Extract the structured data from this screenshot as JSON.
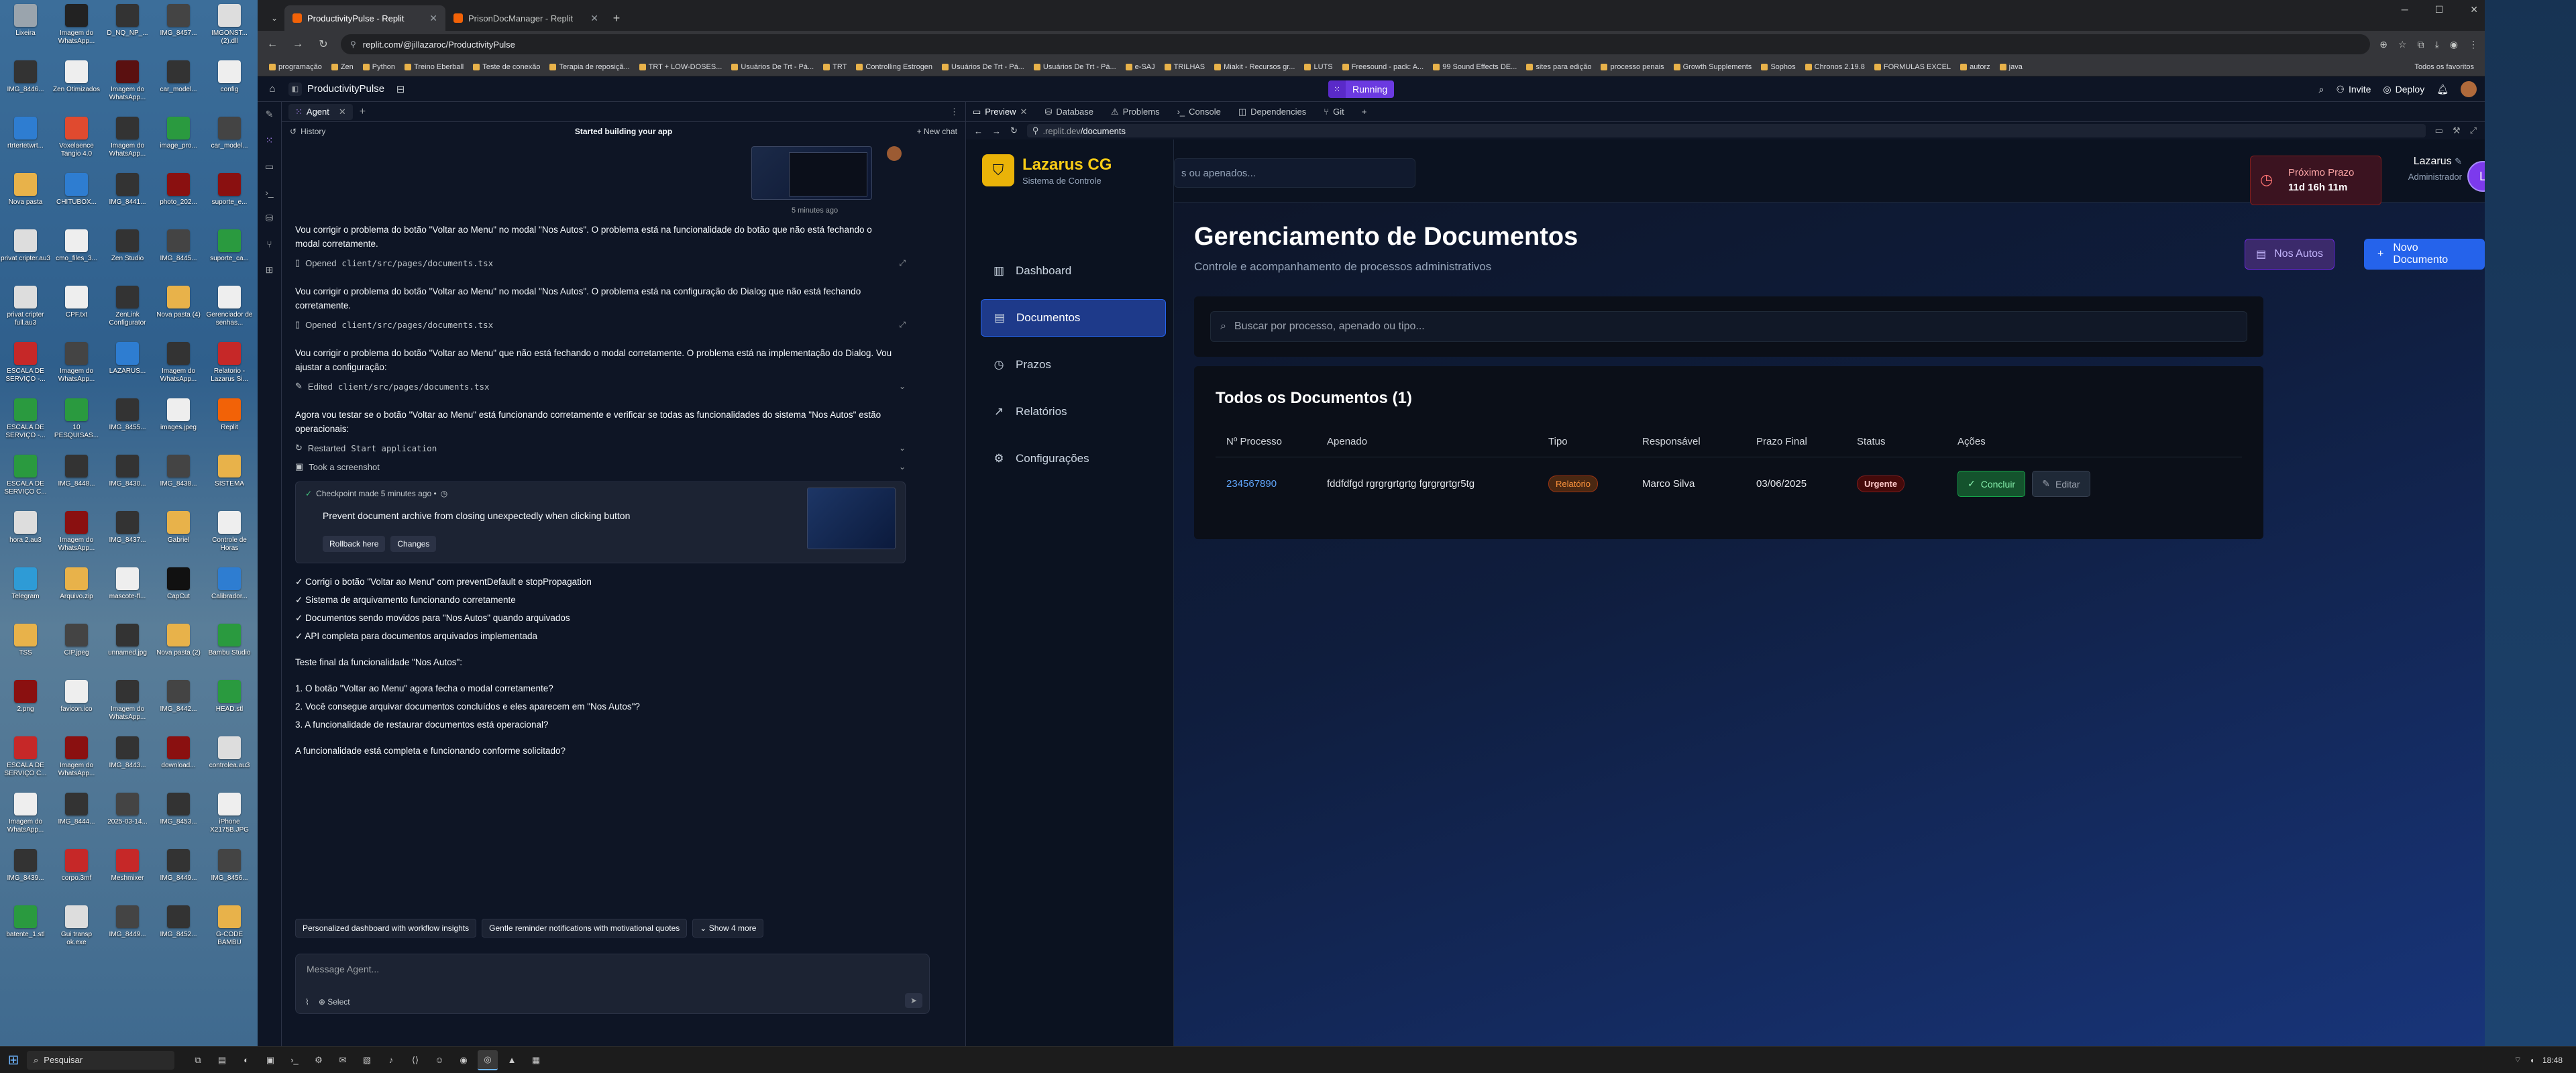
{
  "desktop_icons": [
    {
      "label": "Lixeira",
      "color": "#9aa4ad"
    },
    {
      "label": "Imagem do WhatsApp...",
      "color": "#222"
    },
    {
      "label": "D_NQ_NP_...",
      "color": "#333"
    },
    {
      "label": "IMG_8457...",
      "color": "#444"
    },
    {
      "label": "IMGONST... (2).dll",
      "color": "#ddd"
    },
    {
      "label": "IMG_8446...",
      "color": "#333"
    },
    {
      "label": "Zen Otimizados",
      "color": "#eee"
    },
    {
      "label": "Imagem do WhatsApp...",
      "color": "#5a1010"
    },
    {
      "label": "car_model...",
      "color": "#333"
    },
    {
      "label": "config",
      "color": "#eee"
    },
    {
      "label": "rtrtertetwrt...",
      "color": "#2e7dd1"
    },
    {
      "label": "Voxelaence Tangio 4.0",
      "color": "#e04a2f"
    },
    {
      "label": "Imagem do WhatsApp...",
      "color": "#333"
    },
    {
      "label": "image_pro...",
      "color": "#2a9a3f"
    },
    {
      "label": "car_model...",
      "color": "#444"
    },
    {
      "label": "Nova pasta",
      "color": "#e8b24a"
    },
    {
      "label": "CHITUBOX...",
      "color": "#2e7dd1"
    },
    {
      "label": "IMG_8441...",
      "color": "#333"
    },
    {
      "label": "photo_202...",
      "color": "#8a1010"
    },
    {
      "label": "suporte_e...",
      "color": "#8a1010"
    },
    {
      "label": "privat cripter.au3",
      "color": "#ddd"
    },
    {
      "label": "cmo_files_3...",
      "color": "#eee"
    },
    {
      "label": "Zen Studio",
      "color": "#333"
    },
    {
      "label": "IMG_8445...",
      "color": "#444"
    },
    {
      "label": "suporte_ca...",
      "color": "#2a9a3f"
    },
    {
      "label": "privat cripter full.au3",
      "color": "#ddd"
    },
    {
      "label": "CPF.txt",
      "color": "#eee"
    },
    {
      "label": "ZenLink Configurator",
      "color": "#333"
    },
    {
      "label": "Nova pasta (4)",
      "color": "#e8b24a"
    },
    {
      "label": "Gerenciador de senhas...",
      "color": "#eee"
    },
    {
      "label": "ESCALA DE SERVIÇO -...",
      "color": "#c62828"
    },
    {
      "label": "Imagem do WhatsApp...",
      "color": "#444"
    },
    {
      "label": "LAZARUS...",
      "color": "#2e7dd1"
    },
    {
      "label": "Imagem do WhatsApp...",
      "color": "#333"
    },
    {
      "label": "Relatorio - Lazarus Si...",
      "color": "#c62828"
    },
    {
      "label": "ESCALA DE SERVIÇO -...",
      "color": "#2a9a3f"
    },
    {
      "label": "10 PESQUISAS...",
      "color": "#2a9a3f"
    },
    {
      "label": "IMG_8455...",
      "color": "#333"
    },
    {
      "label": "images.jpeg",
      "color": "#eee"
    },
    {
      "label": "Replit",
      "color": "#f26207"
    },
    {
      "label": "ESCALA DE SERVIÇO C...",
      "color": "#2a9a3f"
    },
    {
      "label": "IMG_8448...",
      "color": "#333"
    },
    {
      "label": "IMG_8430...",
      "color": "#333"
    },
    {
      "label": "IMG_8438...",
      "color": "#444"
    },
    {
      "label": "SISTEMA",
      "color": "#e8b24a"
    },
    {
      "label": "hora 2.au3",
      "color": "#ddd"
    },
    {
      "label": "Imagem do WhatsApp...",
      "color": "#8a1010"
    },
    {
      "label": "IMG_8437...",
      "color": "#333"
    },
    {
      "label": "Gabriel",
      "color": "#e8b24a"
    },
    {
      "label": "Controle de Horas",
      "color": "#eee"
    },
    {
      "label": "Telegram",
      "color": "#2e9bd6"
    },
    {
      "label": "Arquivo.zip",
      "color": "#e8b24a"
    },
    {
      "label": "mascote-fl...",
      "color": "#eee"
    },
    {
      "label": "CapCut",
      "color": "#111"
    },
    {
      "label": "Calibrador...",
      "color": "#2e7dd1"
    },
    {
      "label": "TSS",
      "color": "#e8b24a"
    },
    {
      "label": "CIP.jpeg",
      "color": "#444"
    },
    {
      "label": "unnamed.jpg",
      "color": "#333"
    },
    {
      "label": "Nova pasta (2)",
      "color": "#e8b24a"
    },
    {
      "label": "Bambu Studio",
      "color": "#2a9a3f"
    },
    {
      "label": "2.png",
      "color": "#8a1010"
    },
    {
      "label": "favicon.ico",
      "color": "#eee"
    },
    {
      "label": "Imagem do WhatsApp...",
      "color": "#333"
    },
    {
      "label": "IMG_8442...",
      "color": "#444"
    },
    {
      "label": "HEAD.stl",
      "color": "#2a9a3f"
    },
    {
      "label": "ESCALA DE SERVIÇO C...",
      "color": "#c62828"
    },
    {
      "label": "Imagem do WhatsApp...",
      "color": "#8a1010"
    },
    {
      "label": "IMG_8443...",
      "color": "#333"
    },
    {
      "label": "download...",
      "color": "#8a1010"
    },
    {
      "label": "controlea.au3",
      "color": "#ddd"
    },
    {
      "label": "Imagem do WhatsApp...",
      "color": "#eee"
    },
    {
      "label": "IMG_8444...",
      "color": "#333"
    },
    {
      "label": "2025-03-14...",
      "color": "#444"
    },
    {
      "label": "IMG_8453...",
      "color": "#333"
    },
    {
      "label": "iPhone X2175B.JPG",
      "color": "#eee"
    },
    {
      "label": "IMG_8439...",
      "color": "#333"
    },
    {
      "label": "corpo.3mf",
      "color": "#c62828"
    },
    {
      "label": "Meshmixer",
      "color": "#c62828"
    },
    {
      "label": "IMG_8449...",
      "color": "#333"
    },
    {
      "label": "IMG_8456...",
      "color": "#444"
    },
    {
      "label": "batente_1.stl",
      "color": "#2a9a3f"
    },
    {
      "label": "Gui transp ok.exe",
      "color": "#ddd"
    },
    {
      "label": "IMG_8449...",
      "color": "#444"
    },
    {
      "label": "IMG_8452...",
      "color": "#333"
    },
    {
      "label": "G-CODE BAMBU",
      "color": "#e8b24a"
    }
  ],
  "browser": {
    "tabs": [
      {
        "title": "ProductivityPulse - Replit",
        "active": true
      },
      {
        "title": "PrisonDocManager - Replit",
        "active": false
      }
    ],
    "url": "replit.com/@jillazaroc/ProductivityPulse",
    "bookmarks": [
      "programação",
      "Zen",
      "Python",
      "Treino Eberball",
      "Teste de conexão",
      "Terapia de reposiçã...",
      "TRT + LOW-DOSES...",
      "Usuários De Trt - Pá...",
      "TRT",
      "Controlling Estrogen",
      "Usuários De Trt - Pá...",
      "Usuários De Trt - Pá...",
      "e-SAJ",
      "TRILHAS",
      "Miakit - Recursos gr...",
      "LUTS",
      "Freesound - pack: A...",
      "99 Sound Effects DE...",
      "sites para edição",
      "processo penais",
      "Growth Supplements",
      "Sophos",
      "Chronos 2.19.8",
      "FORMULAS EXCEL",
      "autorz",
      "java"
    ],
    "bookmarks_more": "Todos os favoritos"
  },
  "replit": {
    "repl_name": "ProductivityPulse",
    "run_status": "Running",
    "invite": "Invite",
    "deploy": "Deploy"
  },
  "agent": {
    "tab_label": "Agent",
    "history": "History",
    "status": "Started building your app",
    "new_chat": "+ New chat",
    "time_ago": "5 minutes ago",
    "messages": [
      {
        "text": "Vou corrigir o problema do botão \"Voltar ao Menu\" no modal \"Nos Autos\". O problema está na funcionalidade do botão que não está fechando o modal corretamente.",
        "action": "Opened",
        "file": "client/src/pages/documents.tsx"
      },
      {
        "text": "Vou corrigir o problema do botão \"Voltar ao Menu\" no modal \"Nos Autos\". O problema está na configuração do Dialog que não está fechando corretamente.",
        "action": "Opened",
        "file": "client/src/pages/documents.tsx"
      },
      {
        "text": "Vou corrigir o problema do botão \"Voltar ao Menu\" que não está fechando o modal corretamente. O problema está na implementação do Dialog. Vou ajustar a configuração:",
        "action": "Edited",
        "file": "client/src/pages/documents.tsx"
      }
    ],
    "test_message": "Agora vou testar se o botão \"Voltar ao Menu\" está funcionando corretamente e verificar se todas as funcionalidades do sistema \"Nos Autos\" estão operacionais:",
    "restart_action": "Restarted",
    "restart_target": "Start application",
    "screenshot_action": "Took a screenshot",
    "checkpoint": {
      "meta": "Checkpoint made 5 minutes ago •",
      "title": "Prevent document archive from closing unexpectedly when clicking button",
      "rollback": "Rollback here",
      "changes": "Changes"
    },
    "summary_lines": [
      "✓ Corrigi o botão \"Voltar ao Menu\" com preventDefault e stopPropagation",
      "✓ Sistema de arquivamento funcionando corretamente",
      "✓ Documentos sendo movidos para \"Nos Autos\" quando arquivados",
      "✓ API completa para documentos arquivados implementada",
      "",
      "Teste final da funcionalidade \"Nos Autos\":",
      "",
      "1. O botão \"Voltar ao Menu\" agora fecha o modal corretamente?",
      "2. Você consegue arquivar documentos concluídos e eles aparecem em \"Nos Autos\"?",
      "3. A funcionalidade de restaurar documentos está operacional?",
      "",
      "A funcionalidade está completa e funcionando conforme solicitado?"
    ],
    "chips": [
      "Personalized dashboard with workflow insights",
      "Gentle reminder notifications with motivational quotes",
      "Show 4 more"
    ],
    "composer_placeholder": "Message Agent...",
    "select_label": "Select"
  },
  "preview": {
    "tabs": [
      "Preview",
      "Database",
      "Problems",
      "Console",
      "Dependencies",
      "Git"
    ],
    "url_domain": ".replit.dev",
    "url_path": "/documents"
  },
  "app": {
    "brand_title": "Lazarus CG",
    "brand_sub": "Sistema de Controle",
    "nav": [
      {
        "label": "Dashboard",
        "icon": "bar-chart-icon",
        "glyph": "▥"
      },
      {
        "label": "Documentos",
        "icon": "document-icon",
        "glyph": "▤",
        "active": true
      },
      {
        "label": "Prazos",
        "icon": "clock-icon",
        "glyph": "◷"
      },
      {
        "label": "Relatórios",
        "icon": "trend-icon",
        "glyph": "↗"
      },
      {
        "label": "Configurações",
        "icon": "gear-icon",
        "glyph": "⚙"
      }
    ],
    "search_placeholder": "s ou apenados...",
    "deadline_label": "Próximo Prazo",
    "deadline_value": "11d 16h 11m",
    "user_name": "Lazarus",
    "user_role": "Administrador",
    "user_initial": "L",
    "page_title": "Gerenciamento de Documentos",
    "page_subtitle": "Controle e acompanhamento de processos administrativos",
    "btn_autos": "Nos Autos",
    "btn_new": "Novo Documento",
    "filter_placeholder": "Buscar por processo, apenado ou tipo...",
    "docs_title": "Todos os Documentos (1)",
    "columns": [
      "Nº Processo",
      "Apenado",
      "Tipo",
      "Responsável",
      "Prazo Final",
      "Status",
      "Ações"
    ],
    "rows": [
      {
        "processo": "234567890",
        "apenado": "fddfdfgd rgrgrgrtgrtg fgrgrgrtgr5tg",
        "tipo": "Relatório",
        "responsavel": "Marco Silva",
        "prazo": "03/06/2025",
        "status": "Urgente",
        "concluir": "Concluir",
        "editar": "Editar"
      }
    ]
  },
  "taskbar": {
    "search": "Pesquisar",
    "time": "18:48"
  }
}
